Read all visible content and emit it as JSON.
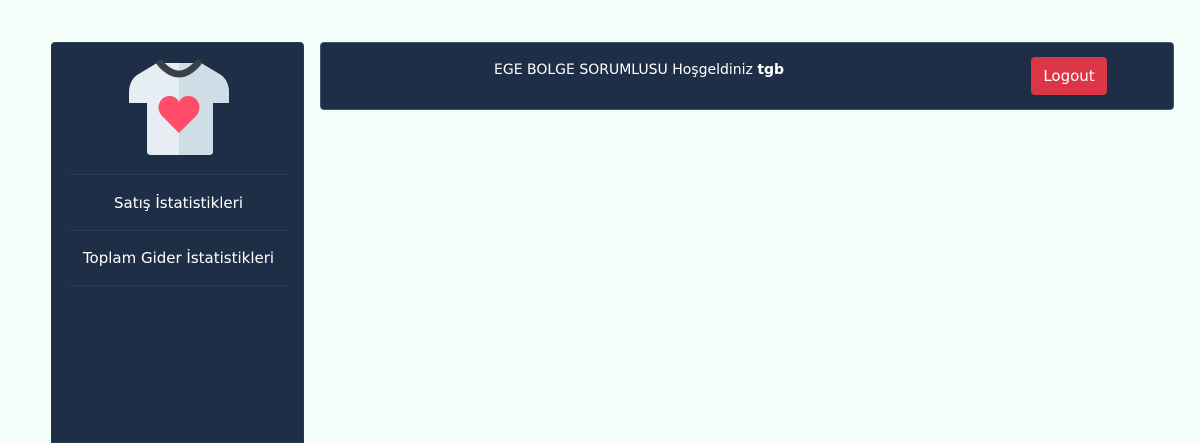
{
  "sidebar": {
    "logo_icon": "tshirt-heart-icon",
    "items": [
      {
        "label": "Satış İstatistikleri"
      },
      {
        "label": "Toplam Gider İstatistikleri"
      }
    ]
  },
  "header": {
    "welcome_text": "EGE BOLGE SORUMLUSU Hoşgeldiniz ",
    "username": "tgb",
    "logout_label": "Logout"
  },
  "colors": {
    "background": "#f4fffa",
    "panel": "#1e2e46",
    "logout": "#dc3545",
    "heart": "#ff4d6a"
  }
}
